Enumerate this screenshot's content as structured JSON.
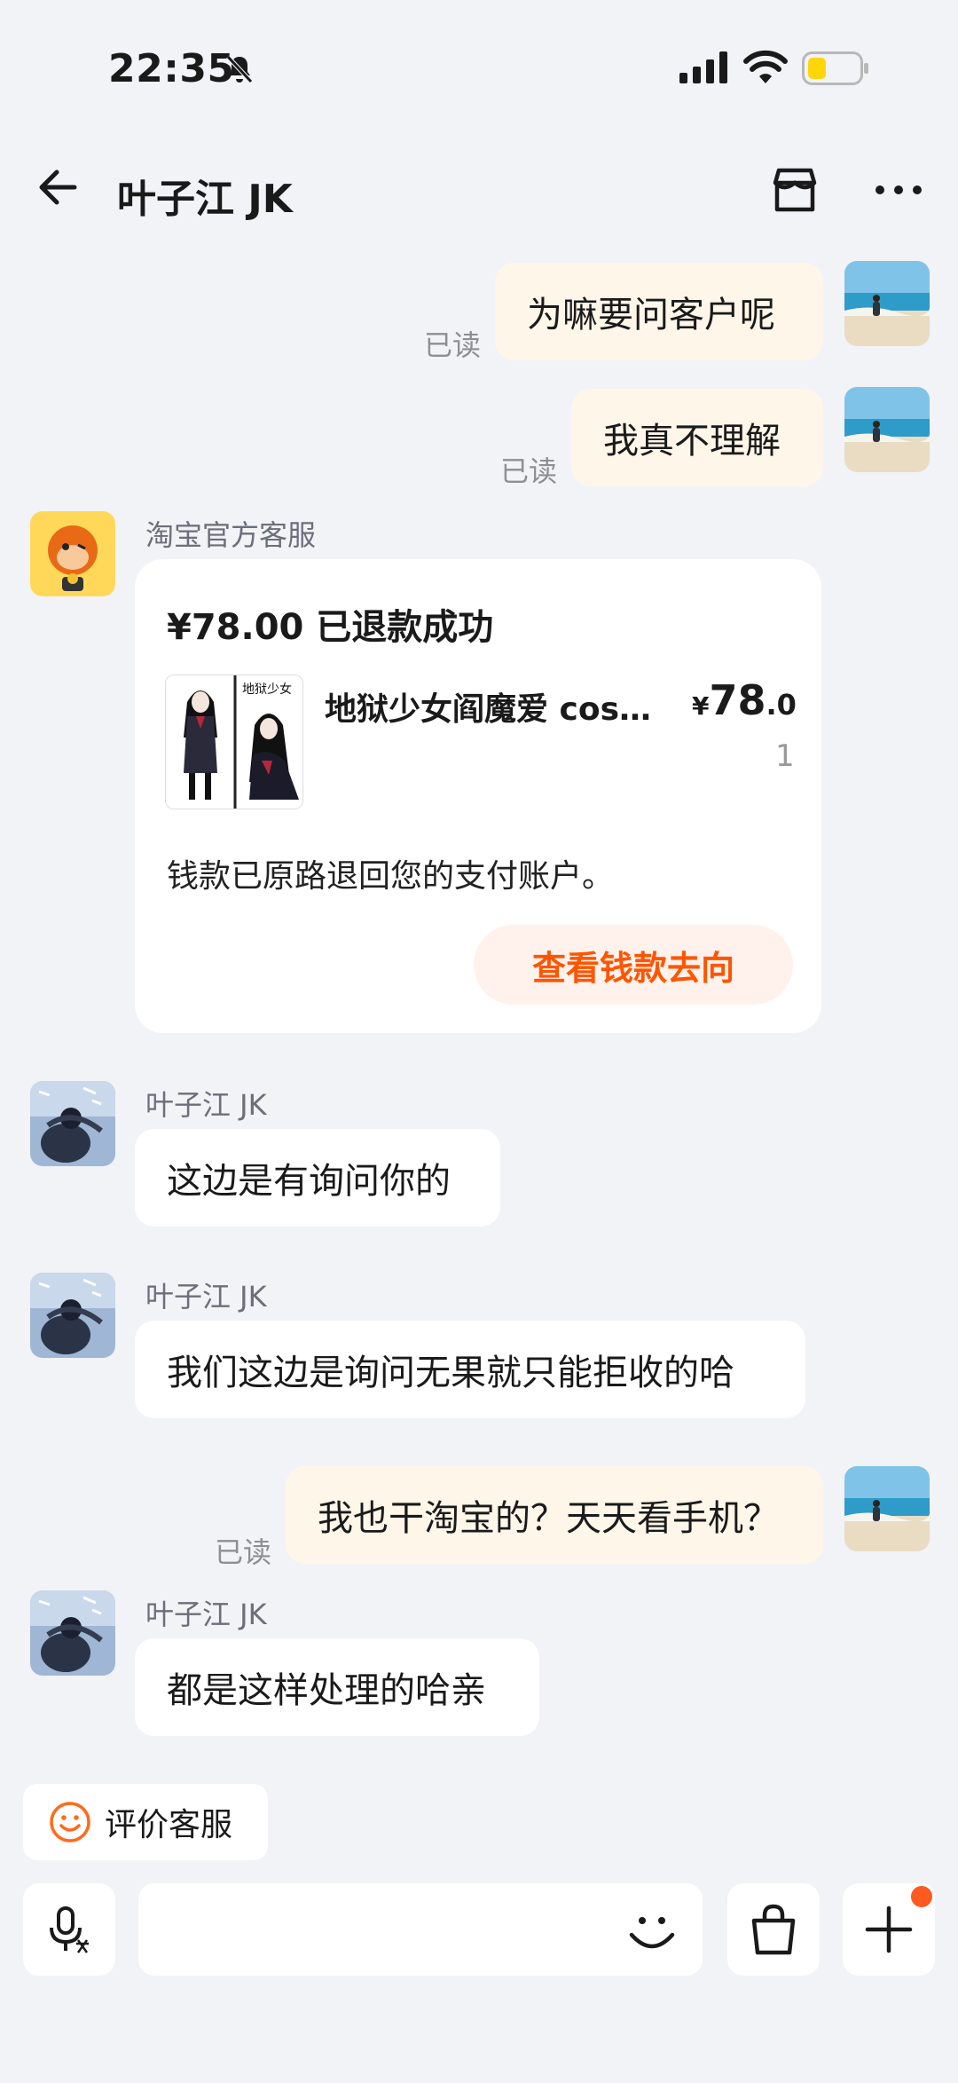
{
  "status_bar": {
    "time": "22:35"
  },
  "header": {
    "title": "叶子江 JK"
  },
  "messages": {
    "m1": {
      "text": "为嘛要问客户呢",
      "read": "已读"
    },
    "m2": {
      "text": "我真不理解",
      "read": "已读"
    },
    "official": {
      "sender": "淘宝官方客服",
      "card": {
        "title": "¥78.00 已退款成功",
        "product": "地狱少女阎魔爱 cos…",
        "thumb_text": "地狱少女",
        "price_currency": "¥",
        "price_int": "78",
        "price_dec": ".0",
        "qty": "1",
        "note": "钱款已原路退回您的支付账户。",
        "button": "查看钱款去向"
      }
    },
    "m3": {
      "sender": "叶子江 JK",
      "text": "这边是有询问你的"
    },
    "m4": {
      "sender": "叶子江 JK",
      "text": "我们这边是询问无果就只能拒收的哈"
    },
    "m5": {
      "text": "我也干淘宝的？天天看手机？",
      "read": "已读"
    },
    "m6": {
      "sender": "叶子江 JK",
      "text": "都是这样处理的哈亲"
    }
  },
  "footer": {
    "rate_label": "评价客服"
  },
  "colors": {
    "accent": "#ff5500",
    "my_bubble": "#fff6ea",
    "background": "#f2f3f7"
  }
}
